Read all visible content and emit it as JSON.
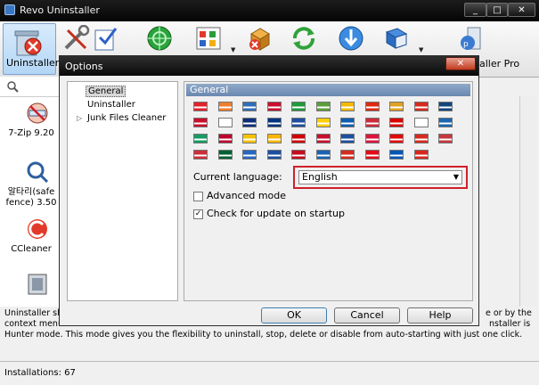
{
  "app": {
    "title": "Revo Uninstaller",
    "window_buttons": {
      "minimize": "_",
      "maximize": "□",
      "close": "✕"
    }
  },
  "toolbar": {
    "uninstaller_label": "Uninstaller",
    "pro_label": "aller Pro",
    "icons": [
      "uninstaller-icon",
      "tools-icon",
      "edit-icon",
      "hunter-icon",
      "autorun-icon",
      "junk-icon",
      "refresh-icon",
      "download-icon",
      "help-book-icon",
      "pro-icon"
    ]
  },
  "left_panel": {
    "programs": [
      {
        "name": "7-Zip 9.20"
      },
      {
        "name": "알타리(safe",
        "name2": "fence) 3.50"
      },
      {
        "name": "CCleaner"
      }
    ]
  },
  "description": {
    "line1": "Uninstaller sho",
    "line1_right": "e or by the",
    "line2": "context menu",
    "line2_right": "nstaller is",
    "line3": "Hunter mode. This mode gives you the flexibility to uninstall, stop, delete or disable from auto-starting with just one click."
  },
  "status": {
    "installations": "Installations: 67"
  },
  "dialog": {
    "title": "Options",
    "close": "✕",
    "tree": {
      "general": "General",
      "uninstaller": "Uninstaller",
      "junk": "Junk Files Cleaner",
      "expander": "▷"
    },
    "panel_title": "General",
    "current_language_label": "Current language:",
    "language_value": "English",
    "advanced_mode_label": "Advanced mode",
    "advanced_mode_checked": false,
    "check_update_label": "Check for update on startup",
    "check_update_checked": true,
    "ok": "OK",
    "cancel": "Cancel",
    "help": "Help"
  },
  "colors": {
    "highlight": "#d0202a",
    "panel_header": "#7a96bb"
  },
  "flags": [
    [
      "#e3212b",
      "#ef7e2d",
      "#2f6db8",
      "#c8102e",
      "#1f9a3c",
      "#5c9e3a",
      "#f3b800",
      "#de2910",
      "#e0a020",
      "#d52b1e",
      "#11457e"
    ],
    [
      "#c8102e",
      "#ffffff",
      "#0f2f7a",
      "#003580",
      "#1e4fa0",
      "#ffce00",
      "#0d5eaf",
      "#cd2a3e",
      "#da0000",
      "#ffffff",
      "#1b66b0"
    ],
    [
      "#169b62",
      "#bc002d",
      "#f6c200",
      "#f8b500",
      "#d20000",
      "#c8102e",
      "#1b4fa0",
      "#dc143c",
      "#e10a0a",
      "#d52b1e",
      "#c6363c"
    ],
    [
      "#cd2e3a",
      "#006233",
      "#2767c2",
      "#1b4fa0",
      "#c60b1e",
      "#1b64b4",
      "#d52b1e",
      "#e30a17",
      "#0057b8",
      "#da251d"
    ]
  ]
}
